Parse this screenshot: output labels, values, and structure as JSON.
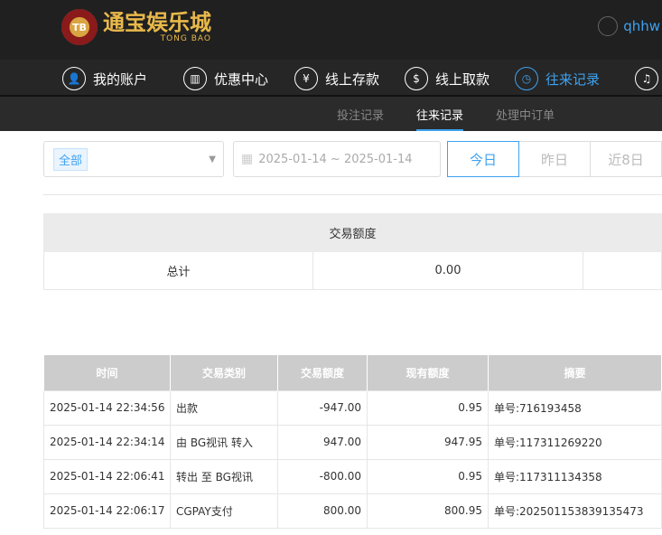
{
  "brand": {
    "logo_cn": "通宝娱乐城",
    "logo_en": "TONG BAO",
    "badge": "TB",
    "username": "qhhw"
  },
  "nav": [
    {
      "label": "我的账户",
      "icon": "user-icon"
    },
    {
      "label": "优惠中心",
      "icon": "gift-icon"
    },
    {
      "label": "线上存款",
      "icon": "deposit-icon"
    },
    {
      "label": "线上取款",
      "icon": "withdraw-icon"
    },
    {
      "label": "往来记录",
      "icon": "record-icon",
      "active": true
    },
    {
      "label": "",
      "icon": "bell-icon"
    }
  ],
  "subnav": [
    {
      "label": "投注记录"
    },
    {
      "label": "往来记录",
      "active": true
    },
    {
      "label": "处理中订单"
    }
  ],
  "filters": {
    "type_tag": "全部",
    "date_range": "2025-01-14 ~ 2025-01-14",
    "quick": [
      "今日",
      "昨日",
      "近8日"
    ]
  },
  "summary": {
    "header": "交易额度",
    "label": "总计",
    "amount": "0.00"
  },
  "table": {
    "headers": [
      "时间",
      "交易类别",
      "交易额度",
      "现有额度",
      "摘要"
    ],
    "rows": [
      [
        "2025-01-14 22:34:56",
        "出款",
        "-947.00",
        "0.95",
        "单号:716193458"
      ],
      [
        "2025-01-14 22:34:14",
        "由 BG视讯 转入",
        "947.00",
        "947.95",
        "单号:117311269220"
      ],
      [
        "2025-01-14 22:06:41",
        "转出 至 BG视讯",
        "-800.00",
        "0.95",
        "单号:117311134358"
      ],
      [
        "2025-01-14 22:06:17",
        "CGPAY支付",
        "800.00",
        "800.95",
        "单号:202501153839135473"
      ]
    ]
  },
  "colors": {
    "accent": "#3ea2f0",
    "header_bg": "#202020"
  }
}
